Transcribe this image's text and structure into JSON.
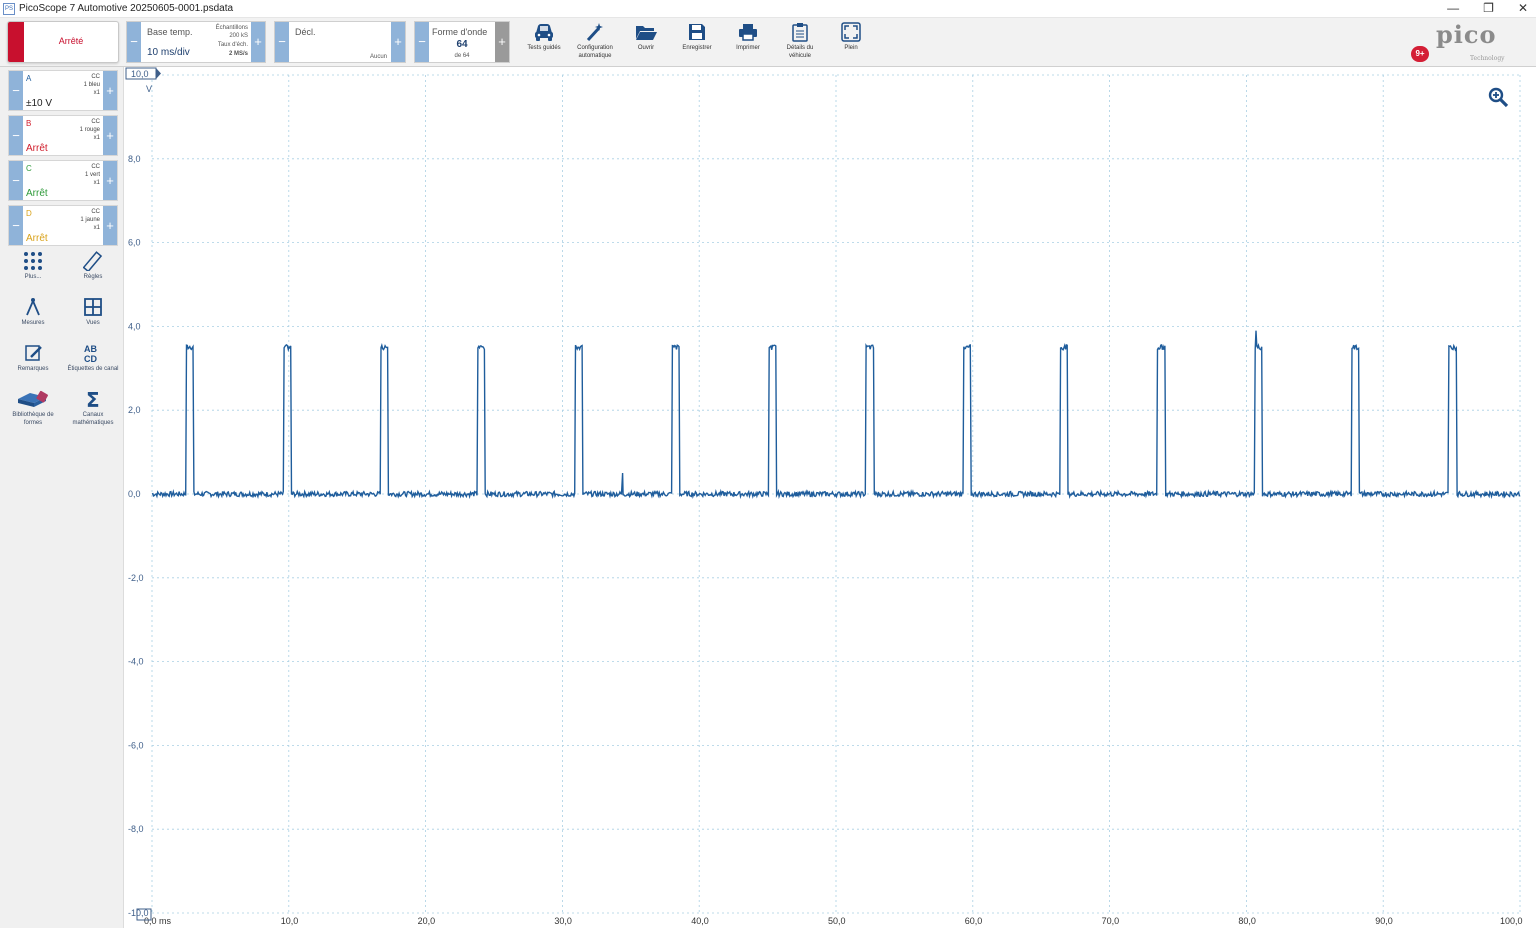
{
  "window": {
    "title": "PicoScope 7 Automotive 20250605-0001.psdata",
    "app_icon": "PS",
    "controls": [
      "—",
      "❐",
      "✕"
    ]
  },
  "toolbar": {
    "run_state": "Arrêté",
    "timebase": {
      "label": "Base temp.",
      "value": "10 ms/div",
      "samples_label": "Échantillons",
      "samples": "200 kS",
      "rate_label": "Taux d'éch.",
      "rate": "2 MS/s"
    },
    "trigger": {
      "label": "Décl.",
      "mode": "Aucun"
    },
    "waveform": {
      "label": "Forme d'onde",
      "current": "64",
      "of": "de 64"
    },
    "buttons": [
      {
        "label": "Tests guidés",
        "icon": "car-icon"
      },
      {
        "label": "Configuration automatique",
        "icon": "wand-icon"
      },
      {
        "label": "Ouvrir",
        "icon": "folder-icon"
      },
      {
        "label": "Enregistrer",
        "icon": "save-icon"
      },
      {
        "label": "Imprimer",
        "icon": "print-icon"
      },
      {
        "label": "Détails du véhicule",
        "icon": "clipboard-icon"
      },
      {
        "label": "Plein",
        "icon": "fullscreen-icon"
      }
    ],
    "notification_badge": "9+",
    "logo": {
      "word": "pico",
      "sub": "Technology"
    }
  },
  "channels": [
    {
      "name": "A",
      "value": "±10 V",
      "coupling": "CC",
      "probe": "1 bleu",
      "scale": "x1",
      "color": "#1f5d9c"
    },
    {
      "name": "B",
      "value": "Arrêt",
      "coupling": "CC",
      "probe": "1 rouge",
      "scale": "x1",
      "color": "#d01c2a"
    },
    {
      "name": "C",
      "value": "Arrêt",
      "coupling": "CC",
      "probe": "1 vert",
      "scale": "x1",
      "color": "#2e9a3a"
    },
    {
      "name": "D",
      "value": "Arrêt",
      "coupling": "CC",
      "probe": "1 jaune",
      "scale": "x1",
      "color": "#d9a21a"
    }
  ],
  "tools": [
    {
      "label": "Plus...",
      "icon": "grid-dots-icon"
    },
    {
      "label": "Règles",
      "icon": "ruler-icon"
    },
    {
      "label": "Mesures",
      "icon": "compass-icon"
    },
    {
      "label": "Vues",
      "icon": "views-grid-icon"
    },
    {
      "label": "Remarques",
      "icon": "note-icon"
    },
    {
      "label": "Étiquettes de canal",
      "icon": "abcd-icon"
    },
    {
      "label": "Bibliothèque de formes",
      "icon": "library-icon"
    },
    {
      "label": "Canaux mathématiques",
      "icon": "sigma-icon"
    }
  ],
  "scope": {
    "y_unit": "V",
    "y_top_marker": "10,0",
    "y_ticks": [
      "8,0",
      "6,0",
      "4,0",
      "2,0",
      "0,0",
      "-2,0",
      "-4,0",
      "-6,0",
      "-8,0",
      "-10,0"
    ],
    "x_ticks": [
      "0,0 ms",
      "10,0",
      "20,0",
      "30,0",
      "40,0",
      "50,0",
      "60,0",
      "70,0",
      "80,0",
      "90,0",
      "100,0"
    ],
    "trace_color": "#1f5d9c",
    "grid_color": "#a9cfe3",
    "zoom_icon": "zoom-in-icon"
  },
  "chart_data": {
    "type": "line",
    "xlim": [
      0,
      100
    ],
    "ylim": [
      -10,
      10
    ],
    "xlabel": "ms",
    "ylabel": "V",
    "grid": true,
    "series": [
      {
        "name": "A",
        "pulse_high_v": 3.5,
        "baseline_v": 0.0,
        "pulse_starts_ms": [
          2.5,
          9.6,
          16.7,
          23.8,
          30.9,
          38.0,
          45.1,
          52.2,
          59.3,
          66.4,
          73.5,
          80.6,
          87.7,
          94.8
        ],
        "pulse_width_ms": 0.55,
        "spikes": [
          {
            "x": 80.7,
            "y": 3.9
          },
          {
            "x": 34.4,
            "y": 0.5
          }
        ]
      }
    ]
  }
}
